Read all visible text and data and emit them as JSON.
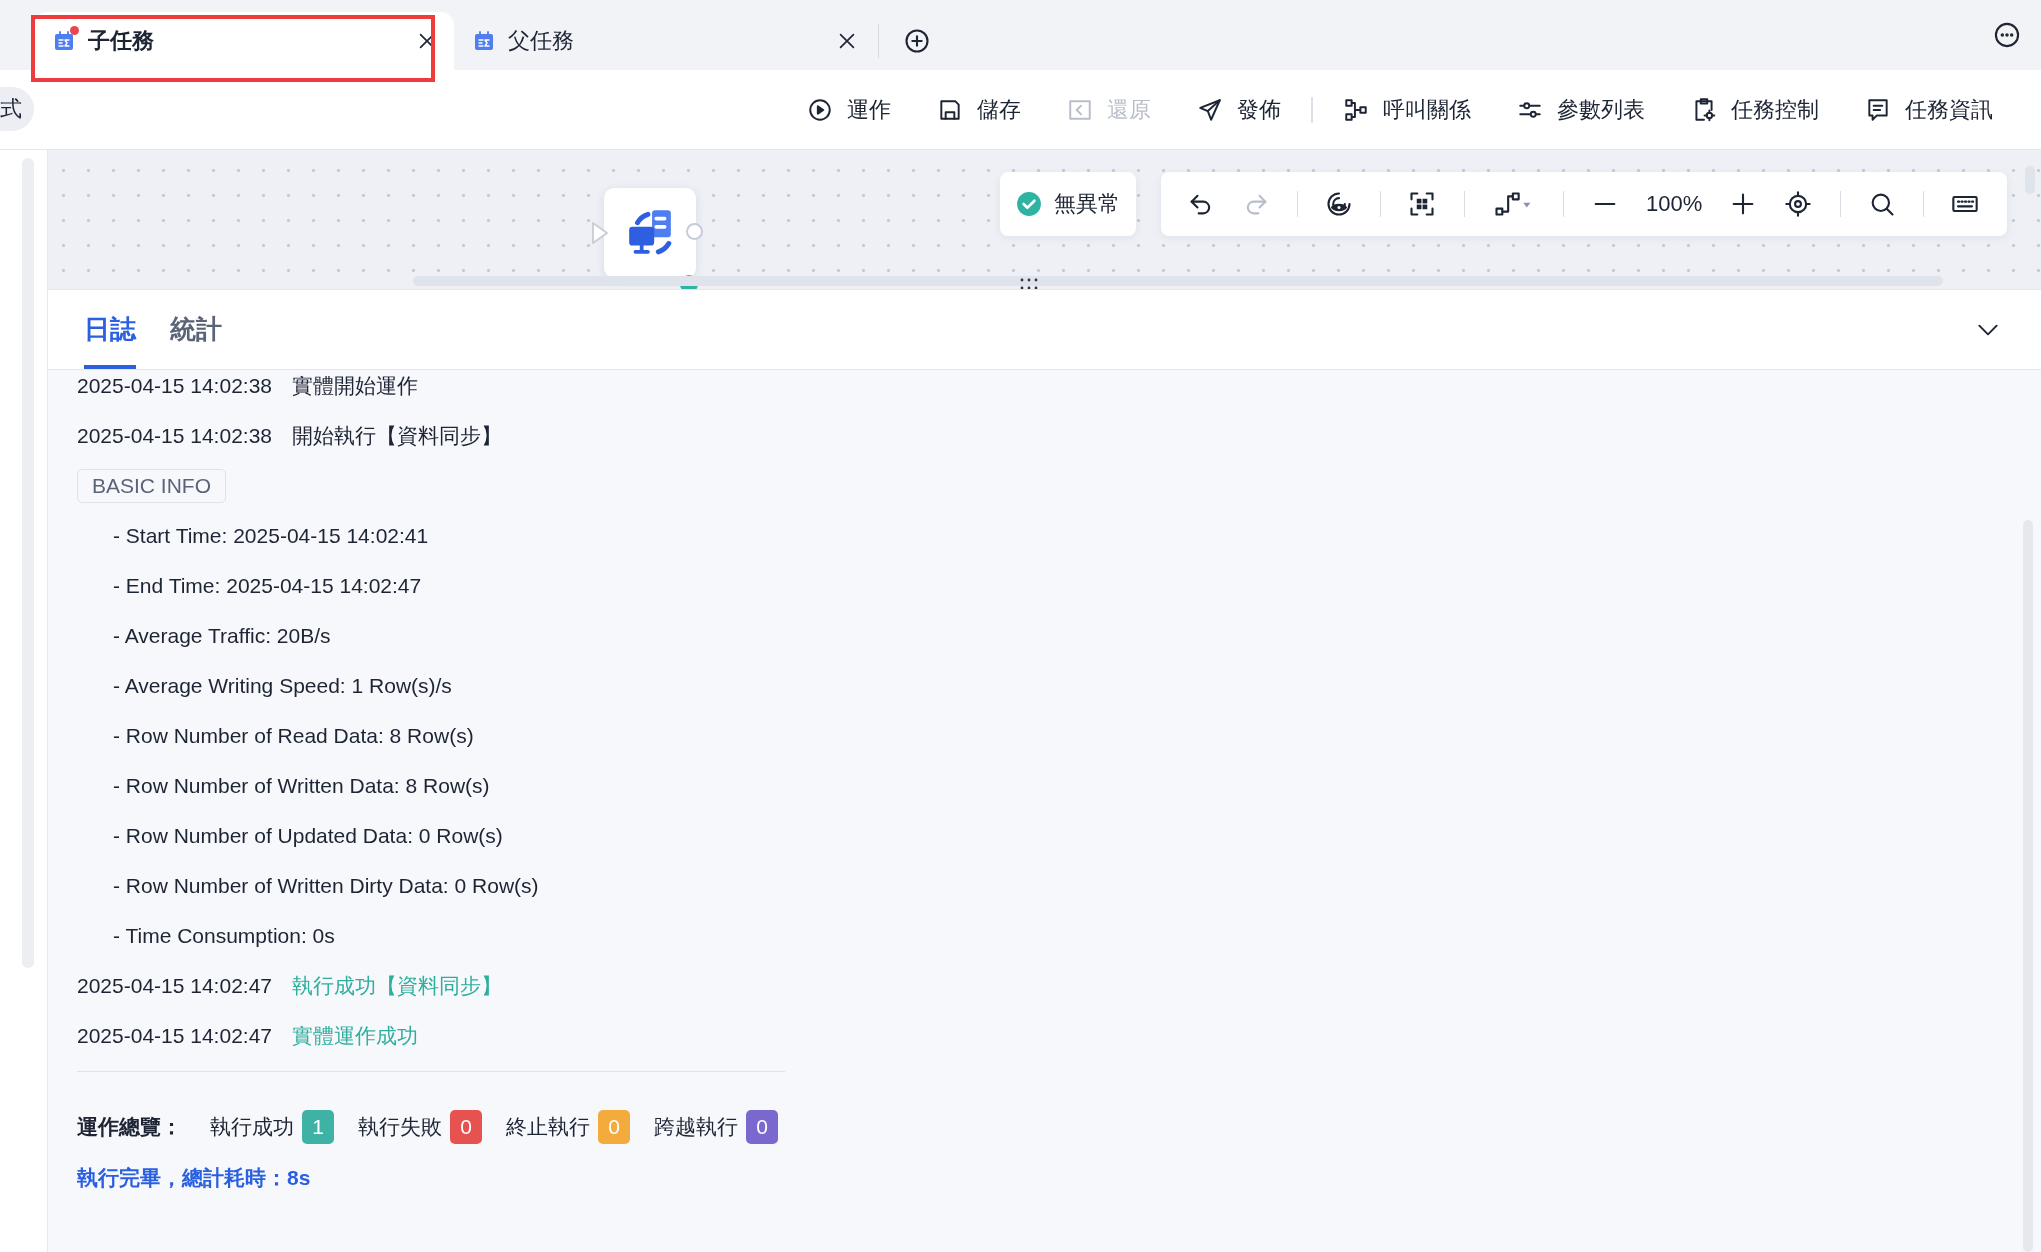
{
  "tabs": [
    {
      "label": "子任務",
      "selected": true,
      "modified": true,
      "highlighted": true
    },
    {
      "label": "父任務",
      "selected": false,
      "modified": false,
      "highlighted": false
    }
  ],
  "side_label": "式",
  "toolbar": [
    {
      "label": "運作",
      "disabled": false,
      "separator_before": false
    },
    {
      "label": "儲存",
      "disabled": false,
      "separator_before": false
    },
    {
      "label": "還原",
      "disabled": true,
      "separator_before": false
    },
    {
      "label": "發佈",
      "disabled": false,
      "separator_before": false
    },
    {
      "label": "呼叫關係",
      "disabled": false,
      "separator_before": true
    },
    {
      "label": "參數列表",
      "disabled": false,
      "separator_before": false
    },
    {
      "label": "任務控制",
      "disabled": false,
      "separator_before": false
    },
    {
      "label": "任務資訊",
      "disabled": false,
      "separator_before": false
    }
  ],
  "canvas": {
    "status": {
      "text": "無異常",
      "ok": true
    },
    "undo_disabled": false,
    "redo_disabled": true,
    "zoom": "100%"
  },
  "log_tabs": [
    {
      "label": "日誌",
      "selected": true
    },
    {
      "label": "統計",
      "selected": false
    }
  ],
  "log": [
    {
      "kind": "entry",
      "time": "2025-04-15 14:02:38",
      "message": "實體開始運作",
      "success": false
    },
    {
      "kind": "entry",
      "time": "2025-04-15 14:02:38",
      "message": "開始執行【資料同步】",
      "success": false
    },
    {
      "kind": "section",
      "title": "BASIC INFO",
      "items": [
        "- Start Time: 2025-04-15 14:02:41",
        "- End Time: 2025-04-15 14:02:47",
        "- Average Traffic: 20B/s",
        "- Average Writing Speed: 1 Row(s)/s",
        "- Row Number of Read Data: 8 Row(s)",
        "- Row Number of Written Data: 8 Row(s)",
        "- Row Number of Updated Data: 0 Row(s)",
        "- Row Number of Written Dirty Data: 0 Row(s)",
        "- Time Consumption: 0s"
      ]
    },
    {
      "kind": "entry",
      "time": "2025-04-15 14:02:47",
      "message": "執行成功【資料同步】",
      "success": true
    },
    {
      "kind": "entry",
      "time": "2025-04-15 14:02:47",
      "message": "實體運作成功",
      "success": true
    }
  ],
  "summary": {
    "label": "運作總覽：",
    "counts": [
      {
        "label": "執行成功",
        "count": "1",
        "color": "#3eb3a5"
      },
      {
        "label": "執行失敗",
        "count": "0",
        "color": "#e5524f"
      },
      {
        "label": "終止執行",
        "count": "0",
        "color": "#f2ab3c"
      },
      {
        "label": "跨越執行",
        "count": "0",
        "color": "#7b68cf"
      }
    ],
    "total": "執行完畢，總計耗時：8s"
  }
}
